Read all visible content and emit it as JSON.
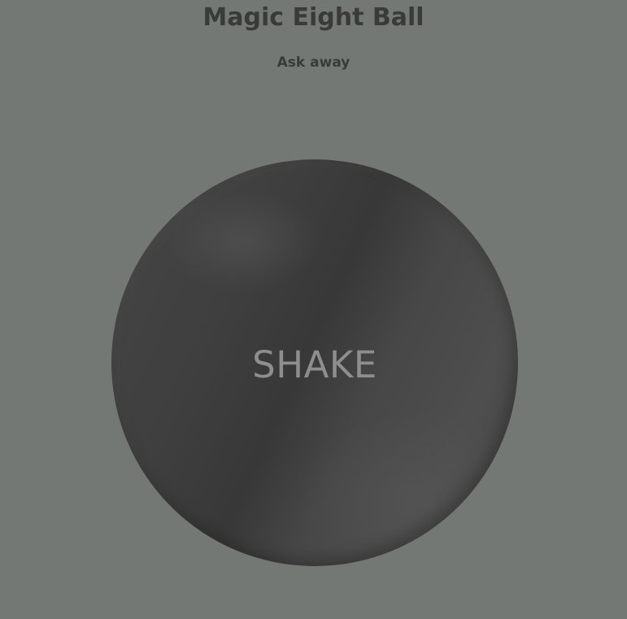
{
  "header": {
    "title": "Magic Eight Ball",
    "subtitle": "Ask away"
  },
  "ball": {
    "label": "SHAKE"
  },
  "colors": {
    "background": "#747874",
    "title_text": "#3a3a3a",
    "ball_base": "#444444",
    "ball_label": "#8e8e8e"
  }
}
